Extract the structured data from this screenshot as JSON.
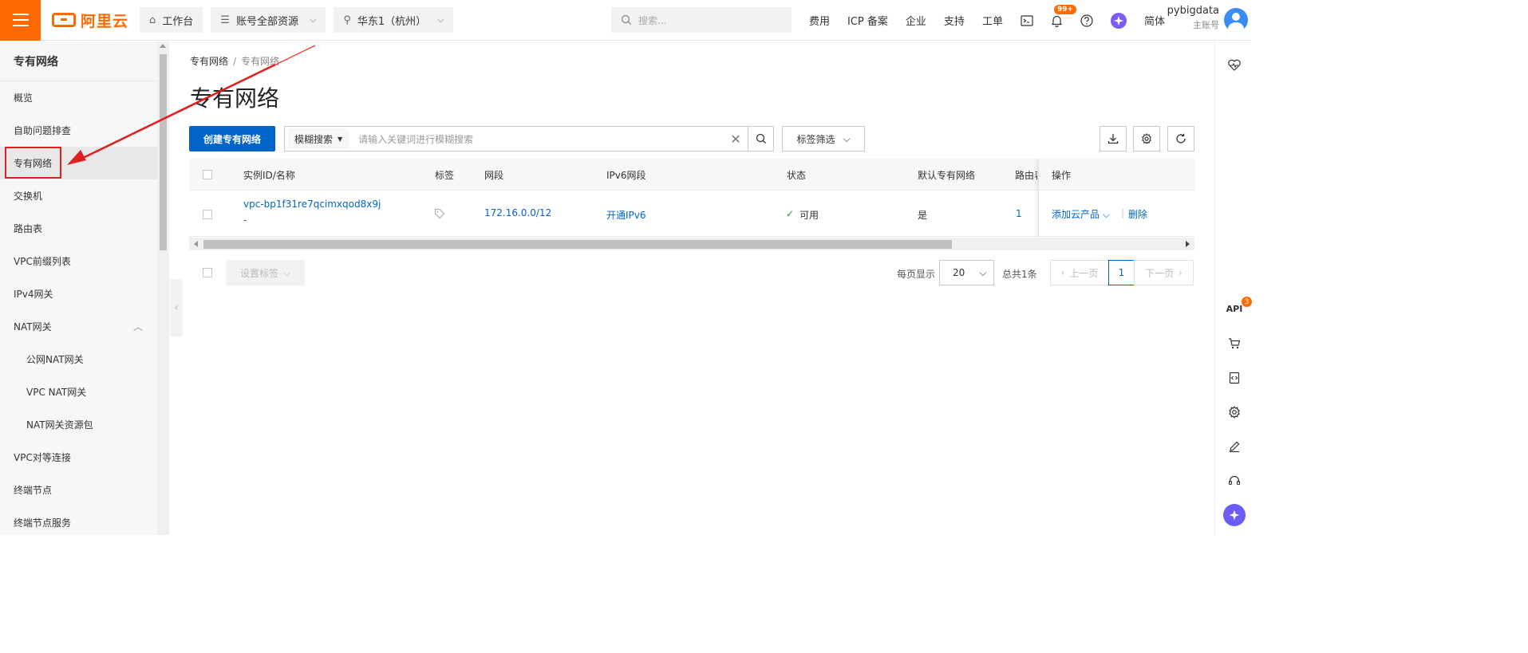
{
  "brand": {
    "logo_text": "阿里云",
    "accent": "#ff6a00",
    "primary": "#0064c8"
  },
  "topbar": {
    "workbench": "工作台",
    "resource_scope": "账号全部资源",
    "region": "华东1（杭州）",
    "search_placeholder": "搜索...",
    "links": [
      "费用",
      "ICP 备案",
      "企业",
      "支持",
      "工单"
    ],
    "notification_badge": "99+",
    "language": "简体",
    "user_name": "pybigdata",
    "user_role": "主账号"
  },
  "sidebar": {
    "title": "专有网络",
    "items": [
      {
        "label": "概览"
      },
      {
        "label": "自助问题排查"
      },
      {
        "label": "专有网络"
      },
      {
        "label": "交换机"
      },
      {
        "label": "路由表"
      },
      {
        "label": "VPC前缀列表"
      },
      {
        "label": "IPv4网关"
      },
      {
        "label": "NAT网关"
      },
      {
        "label": "公网NAT网关"
      },
      {
        "label": "VPC NAT网关"
      },
      {
        "label": "NAT网关资源包"
      },
      {
        "label": "VPC对等连接"
      },
      {
        "label": "终端节点"
      },
      {
        "label": "终端节点服务"
      }
    ]
  },
  "main": {
    "breadcrumb": [
      "专有网络",
      "专有网络"
    ],
    "title": "专有网络",
    "create_button": "创建专有网络",
    "search_type": "模糊搜索",
    "search_placeholder": "请输入关键词进行模糊搜索",
    "tag_filter": "标签筛选",
    "columns": [
      "实例ID/名称",
      "标签",
      "网段",
      "IPv6网段",
      "状态",
      "默认专有网络",
      "路由表",
      "操作"
    ],
    "rows": [
      {
        "id": "vpc-bp1f31re7qcimxqod8x9j",
        "name": "-",
        "cidr": "172.16.0.0/12",
        "ipv6": "开通IPv6",
        "status": "可用",
        "is_default": "是",
        "route_tables": "1",
        "op_add": "添加云产品",
        "op_delete": "删除"
      }
    ],
    "footer": {
      "set_tag": "设置标签",
      "per_page_label": "每页显示",
      "per_page": "20",
      "total": "总共1条",
      "prev": "上一页",
      "page": "1",
      "next": "下一页"
    }
  },
  "right_rail": {
    "api_label": "API",
    "api_badge": "3"
  }
}
